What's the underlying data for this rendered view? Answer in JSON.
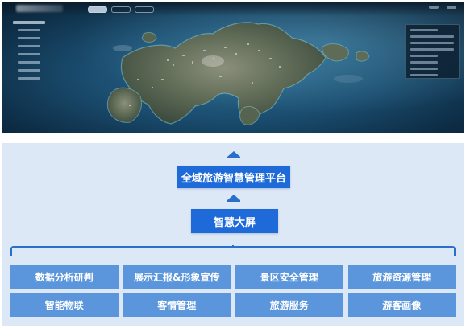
{
  "diagram": {
    "platform_label": "全域旅游智慧管理平台",
    "screen_label": "智慧大屏",
    "modules": [
      "数据分析研判",
      "展示汇报&形象宣传",
      "景区安全管理",
      "旅游资源管理",
      "智能物联",
      "客情管理",
      "旅游服务",
      "游客画像"
    ]
  },
  "colors": {
    "primary_box": "#1e6ad8",
    "module_box": "#5b96dd",
    "arrow": "#2a6fc9",
    "diagram_bg": "#dde8f7",
    "sea": "#1a4c6e"
  },
  "icons": {
    "arrow_top": "up-arrow-icon",
    "arrow_bottom": "up-arrow-icon",
    "bracket": "bracket-connector"
  }
}
